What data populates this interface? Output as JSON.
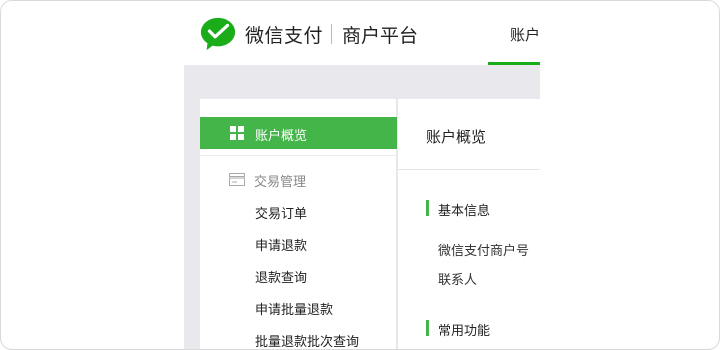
{
  "header": {
    "brand": "微信支付",
    "platform": "商户平台",
    "active_tab": "账户"
  },
  "sidebar": {
    "active_item": "账户概览",
    "group": {
      "title": "交易管理",
      "items": [
        "交易订单",
        "申请退款",
        "退款查询",
        "申请批量退款",
        "批量退款批次查询"
      ]
    }
  },
  "content": {
    "title": "账户概览",
    "sections": [
      {
        "title": "基本信息",
        "fields": [
          "微信支付商户号",
          "联系人"
        ]
      },
      {
        "title": "常用功能",
        "fields": []
      }
    ]
  },
  "colors": {
    "brand_green": "#1aad19",
    "nav_active_bg": "#44b549",
    "page_bg": "#e9e9ed"
  }
}
